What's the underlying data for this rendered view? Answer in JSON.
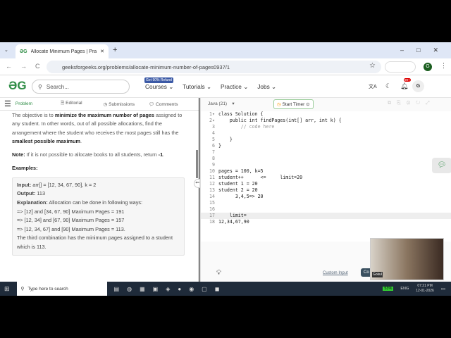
{
  "browser": {
    "tab_title": "Allocate Minimum Pages | Prac",
    "url": "geeksforgeeks.org/problems/allocate-minimum-number-of-pages0937/1",
    "profile": "G"
  },
  "header": {
    "search_placeholder": "Search...",
    "badge": "Get 90% Refund",
    "nav": [
      "Courses",
      "Tutorials",
      "Practice",
      "Jobs"
    ],
    "notif": "99+",
    "avatar": "G"
  },
  "subtabs": [
    "Problem",
    "Editorial",
    "Submissions",
    "Comments"
  ],
  "problem": {
    "intro_prefix": "The objective is to ",
    "intro_bold": "minimize the maximum number of pages",
    "intro_rest": " assigned to any student. In other words, out of all possible allocations, find the arrangement where the student who receives the most pages still has the ",
    "intro_bold2": "smallest possible maximum",
    "note_label": "Note:",
    "note_text": " If it is not possible to allocate books to all students, return ",
    "note_val": "-1",
    "examples_label": "Examples:",
    "input_label": "Input:",
    "input_val": " arr[] = [12, 34, 67, 90], k = 2",
    "output_label": "Output:",
    "output_val": " 113",
    "expl_label": "Explanation:",
    "expl_val": " Allocation can be done in following ways:",
    "lines": [
      "=> [12] and [34, 67, 90] Maximum Pages = 191",
      "=> [12, 34] and [67, 90] Maximum Pages = 157",
      "=> [12, 34, 67] and [90] Maximum Pages = 113.",
      "The third combination has the minimum pages assigned to a student which is 113."
    ]
  },
  "editor": {
    "language": "Java (21)",
    "timer": "Start Timer",
    "lines": [
      "class Solution {",
      "    public int findPages(int[] arr, int k) {",
      "        // code here",
      "",
      "    }",
      "}",
      "",
      "",
      "",
      "pages = 100, k=5",
      "student++      <=     limit=20",
      "student 1 = 20",
      "student 2 = 20",
      "      3,4,5=> 20",
      "",
      "",
      "    limit=",
      "12,34,67,90"
    ],
    "custom_input": "Custom Input",
    "compile": "Co",
    "webcam_name": "Gokul"
  },
  "taskbar": {
    "search": "Type here to search",
    "battery": "53%",
    "lang": "ENG",
    "time": "07:21 PM",
    "date": "12-01-2026"
  }
}
